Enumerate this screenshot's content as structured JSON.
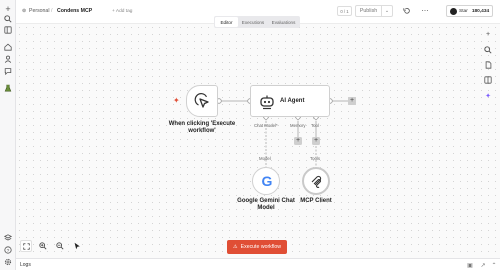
{
  "header": {
    "breadcrumb_project": "Personal",
    "breadcrumb_sep": "/",
    "workflow_name": "Condens MCP",
    "add_tag": "+ Add tag",
    "counter": "0 / 1",
    "publish": "Publish",
    "star_label": "Star",
    "star_count": "180,434"
  },
  "tabs": [
    "Editor",
    "Executions",
    "Evaluations"
  ],
  "nodes": {
    "trigger": {
      "label": "When clicking 'Execute workflow'"
    },
    "agent": {
      "label": "AI Agent",
      "ports": [
        "Chat Model*",
        "Memory",
        "Tool"
      ]
    },
    "gemini": {
      "label": "Google Gemini Chat Model",
      "conn_label": "Model"
    },
    "mcp": {
      "label": "MCP Client",
      "conn_label": "Tools"
    }
  },
  "execute_button": "Execute workflow",
  "logs": {
    "title": "Logs"
  },
  "colors": {
    "accent": "#e04e35",
    "node_border": "#d0d0d0"
  },
  "icons": {
    "sidebar": [
      "plus-icon",
      "search-icon",
      "panel-icon",
      "home-icon",
      "person-icon",
      "chat-icon",
      "flask-icon",
      "template-icon",
      "help-icon",
      "settings-icon"
    ],
    "right": [
      "plus-icon",
      "search-icon",
      "document-icon",
      "panel-icon",
      "sparkle-icon"
    ]
  }
}
